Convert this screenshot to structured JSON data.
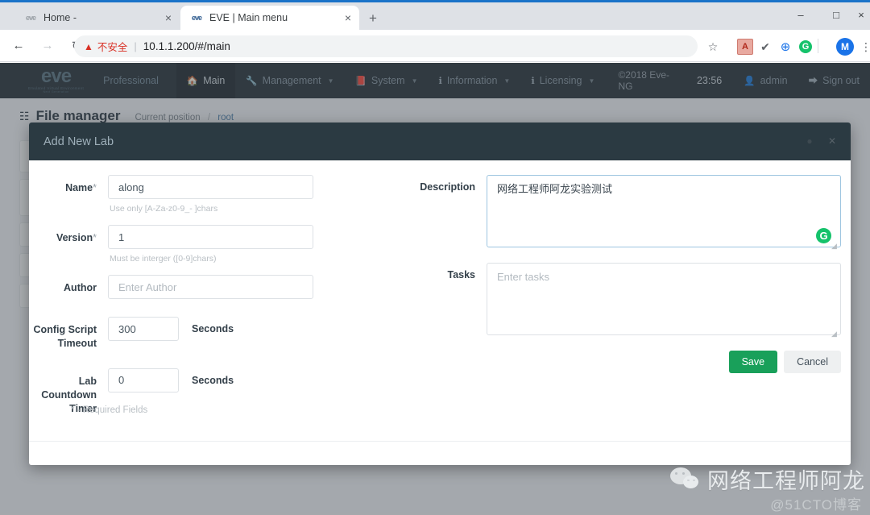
{
  "browser": {
    "tabs": [
      {
        "title": "Home -",
        "favicon": "eve-grey-icon",
        "active": false,
        "close_label": "×"
      },
      {
        "title": "EVE | Main menu",
        "favicon": "eve-blue-icon",
        "active": true,
        "close_label": "×"
      }
    ],
    "new_tab_label": "+",
    "window_controls": {
      "minimize": "–",
      "maximize": "□",
      "close": "×"
    },
    "nav": {
      "back": "←",
      "forward": "→",
      "reload": "↻"
    },
    "omnibox": {
      "security_icon": "warning-triangle-icon",
      "security_text": "不安全",
      "divider": "|",
      "url": "10.1.1.200/#/main"
    },
    "toolbar_icons": {
      "bookmark": "☆",
      "pdf": "A",
      "pen": "✔",
      "blue": "⊕",
      "grammarly": "G",
      "profile": "M",
      "menu": "⋮"
    }
  },
  "eve_nav": {
    "logo": {
      "word": "eve",
      "sub1": "Emulated Virtual Environment",
      "sub2": "Next Generation"
    },
    "items": [
      {
        "label": "Professional",
        "icon": "",
        "active": false,
        "caret": false
      },
      {
        "label": "Main",
        "icon": "🏠",
        "active": true,
        "caret": false
      },
      {
        "label": "Management",
        "icon": "🔧",
        "active": false,
        "caret": true
      },
      {
        "label": "System",
        "icon": "📕",
        "active": false,
        "caret": true
      },
      {
        "label": "Information",
        "icon": "ℹ",
        "active": false,
        "caret": true
      },
      {
        "label": "Licensing",
        "icon": "ℹ",
        "active": false,
        "caret": true
      }
    ],
    "copyright": "©2018 Eve-NG",
    "clock": "23:56",
    "user": {
      "icon": "👤",
      "label": "admin"
    },
    "signout": {
      "icon": "⮕",
      "label": "Sign out"
    }
  },
  "background_page": {
    "title": "File manager",
    "title_icon": "sitemap-icon",
    "breadcrumb_label": "Current position",
    "breadcrumb_sep": "/",
    "breadcrumb_current": "root"
  },
  "modal": {
    "title": "Add New Lab",
    "minimize_icon": "●",
    "close_icon": "✕",
    "fields": {
      "name": {
        "label": "Name",
        "required_mark": "*",
        "value": "along",
        "hint": "Use only [A-Za-z0-9_- ]chars"
      },
      "version": {
        "label": "Version",
        "required_mark": "*",
        "value": "1",
        "hint": "Must be interger ([0-9]chars)"
      },
      "author": {
        "label": "Author",
        "value": "",
        "placeholder": "Enter Author"
      },
      "config_script_timeout": {
        "label": "Config Script Timeout",
        "value": "300",
        "unit": "Seconds"
      },
      "lab_countdown_timer": {
        "label": "Lab Countdown Timer",
        "value": "0",
        "unit": "Seconds"
      },
      "description": {
        "label": "Description",
        "value": "网络工程师阿龙实验测试",
        "grammarly_icon": "G"
      },
      "tasks": {
        "label": "Tasks",
        "value": "",
        "placeholder": "Enter tasks"
      }
    },
    "buttons": {
      "save": "Save",
      "cancel": "Cancel"
    },
    "required_note": "* - Required Fields"
  },
  "watermark": {
    "icon": "wechat-icon",
    "name": "网络工程师阿龙",
    "handle": "@51CTO博客"
  },
  "colors": {
    "nav_bg": "#242f36",
    "modal_header": "#2b3a42",
    "save_green": "#19a05a",
    "grammarly_green": "#15c26b",
    "warning_red": "#d93025",
    "accent_blue": "#1a73e8"
  }
}
